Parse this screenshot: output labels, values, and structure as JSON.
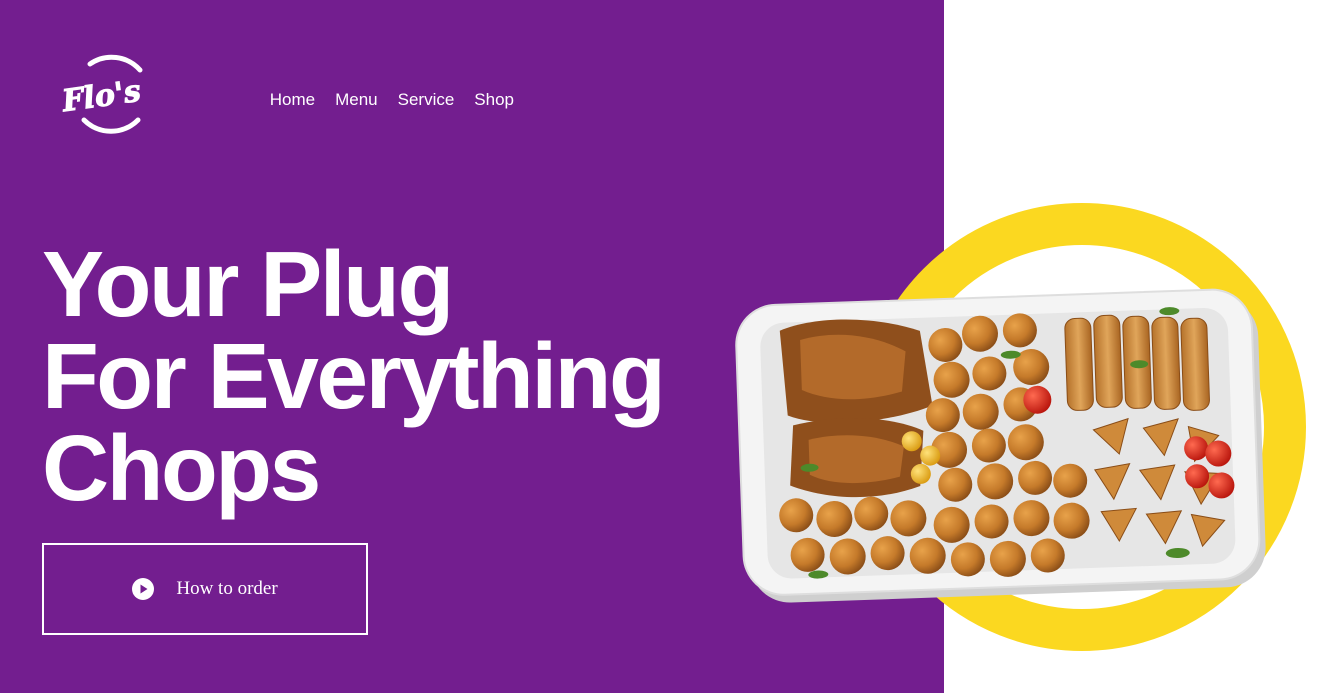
{
  "brand": {
    "logo_text": "Flo's"
  },
  "nav": {
    "items": [
      "Home",
      "Menu",
      "Service",
      "Shop"
    ]
  },
  "hero": {
    "headline_lines": [
      "Your Plug",
      "For Everything",
      "Chops"
    ],
    "cta_label": "How to order"
  },
  "colors": {
    "primary_purple": "#731e8f",
    "accent_yellow": "#fbd820",
    "text": "#ffffff"
  },
  "icons": {
    "cta": "play-circle-icon"
  }
}
